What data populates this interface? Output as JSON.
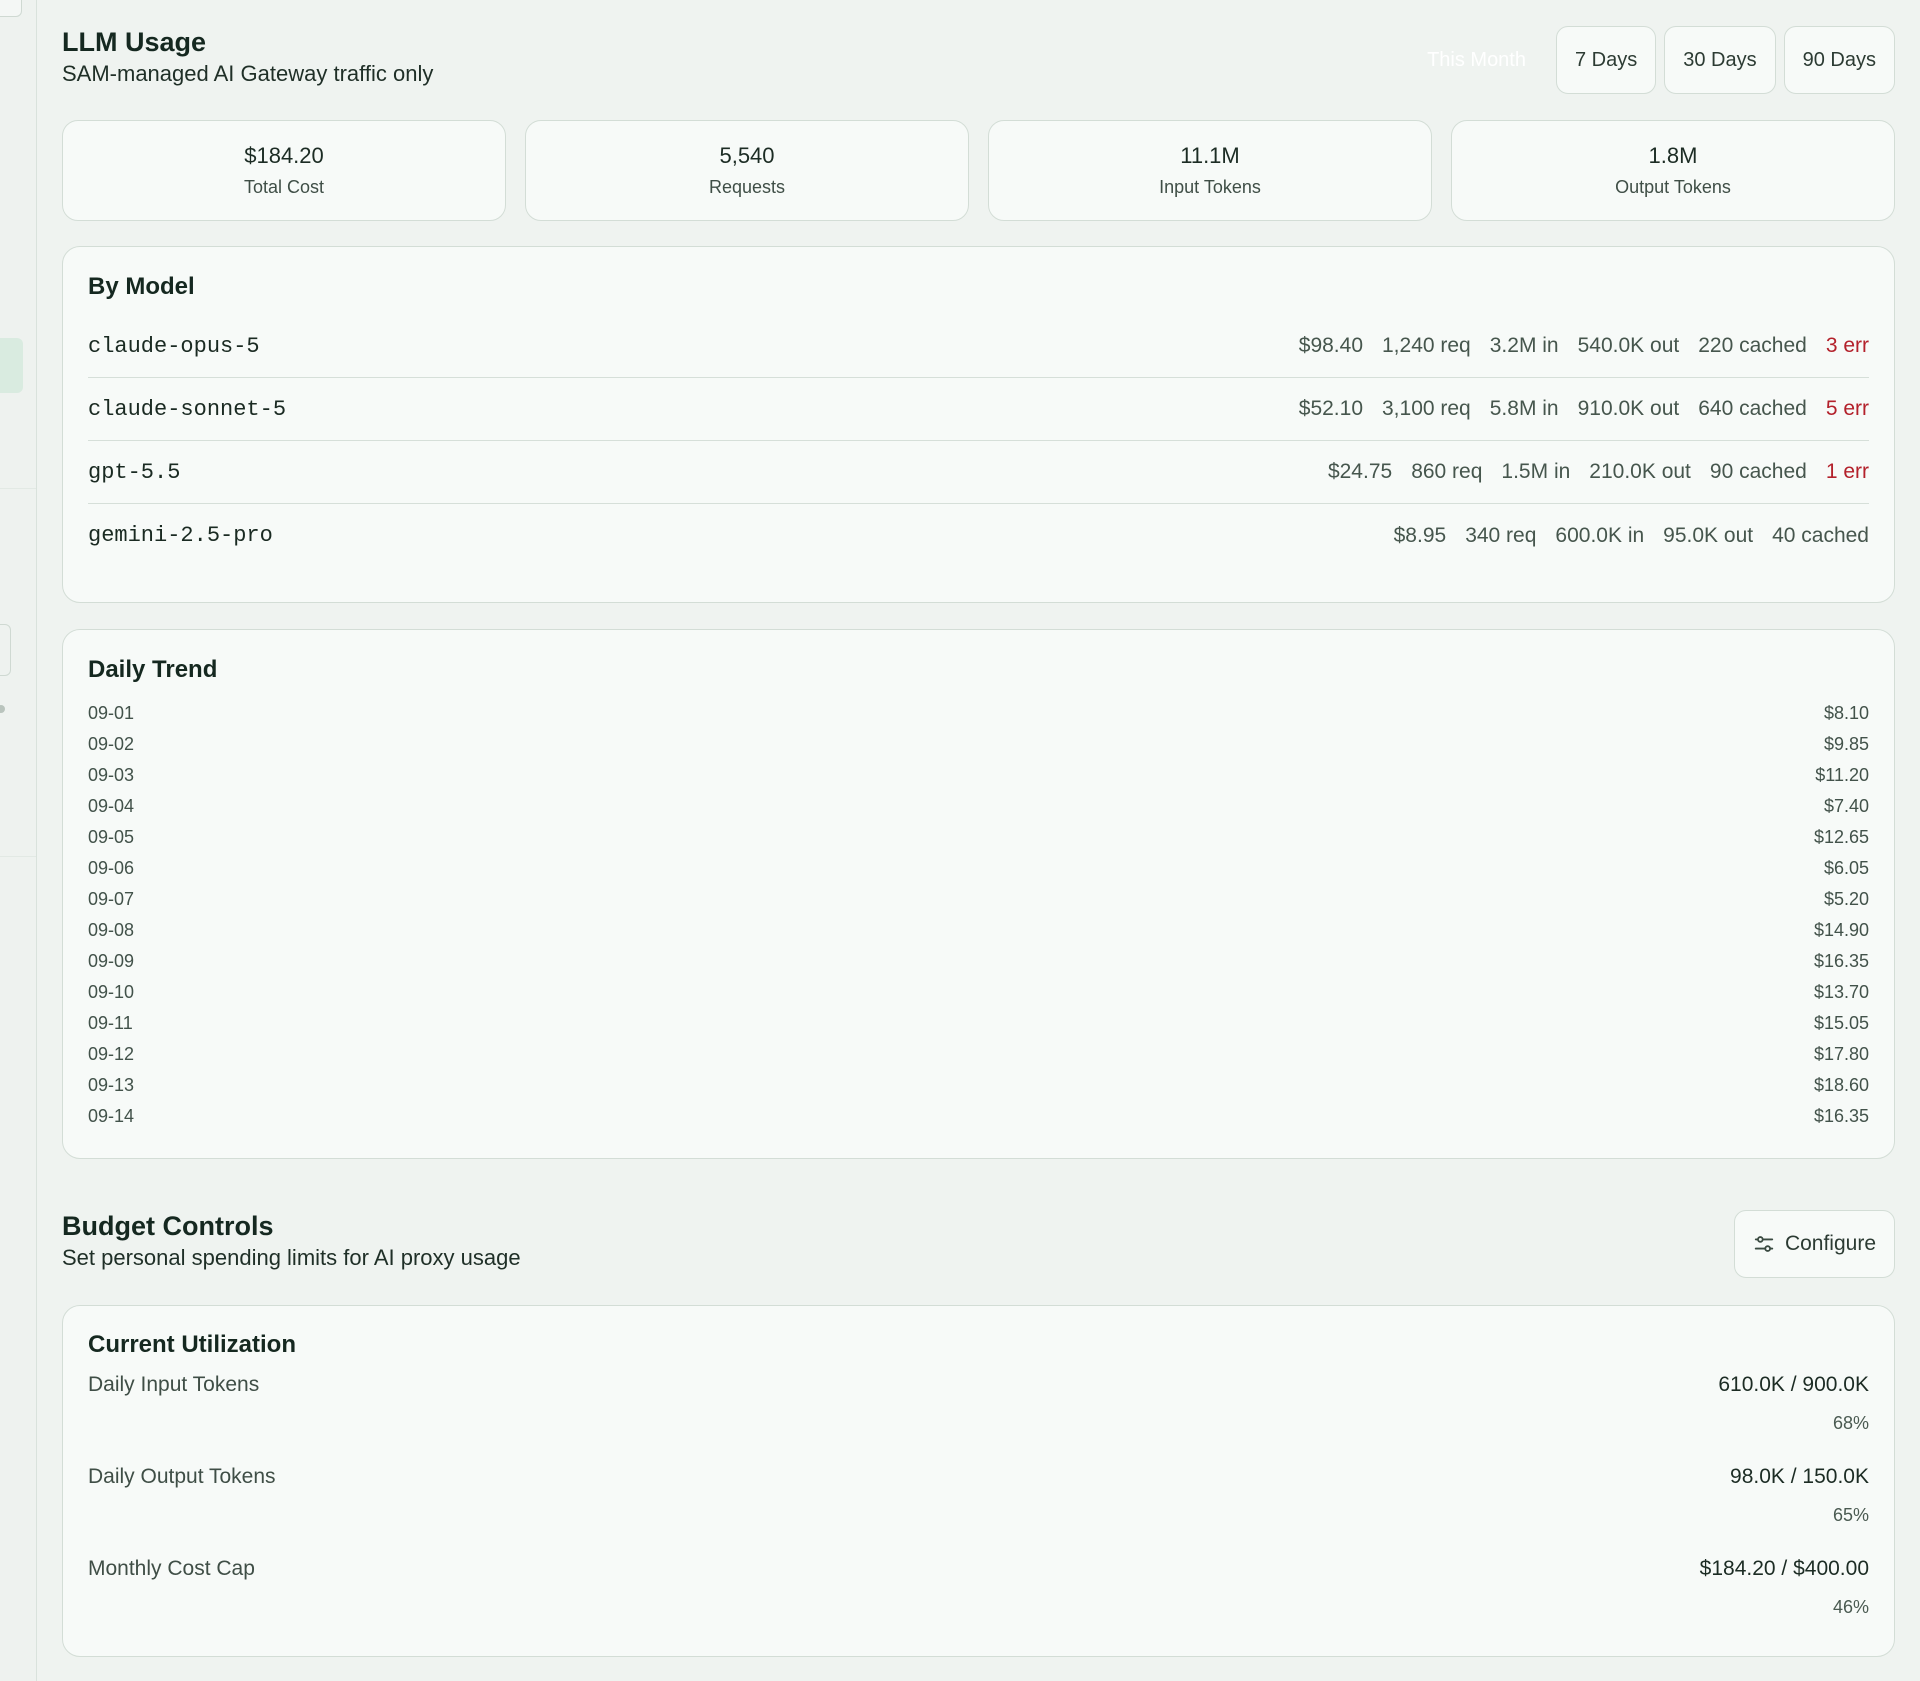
{
  "header": {
    "title": "LLM Usage",
    "subtitle": "SAM-managed AI Gateway traffic only"
  },
  "range": {
    "active": "This Month",
    "options": [
      "7 Days",
      "30 Days",
      "90 Days"
    ]
  },
  "stats": [
    {
      "value": "$184.20",
      "label": "Total Cost"
    },
    {
      "value": "5,540",
      "label": "Requests"
    },
    {
      "value": "11.1M",
      "label": "Input Tokens"
    },
    {
      "value": "1.8M",
      "label": "Output Tokens"
    }
  ],
  "by_model": {
    "title": "By Model",
    "rows": [
      {
        "name": "claude-opus-5",
        "cost": "$98.40",
        "req": "1,240 req",
        "in": "3.2M in",
        "out": "540.0K out",
        "cached": "220 cached",
        "err": "3 err"
      },
      {
        "name": "claude-sonnet-5",
        "cost": "$52.10",
        "req": "3,100 req",
        "in": "5.8M in",
        "out": "910.0K out",
        "cached": "640 cached",
        "err": "5 err"
      },
      {
        "name": "gpt-5.5",
        "cost": "$24.75",
        "req": "860 req",
        "in": "1.5M in",
        "out": "210.0K out",
        "cached": "90 cached",
        "err": "1 err"
      },
      {
        "name": "gemini-2.5-pro",
        "cost": "$8.95",
        "req": "340 req",
        "in": "600.0K in",
        "out": "95.0K out",
        "cached": "40 cached",
        "err": ""
      }
    ]
  },
  "daily_trend": {
    "title": "Daily Trend",
    "rows": [
      {
        "date": "09-01",
        "cost": "$8.10"
      },
      {
        "date": "09-02",
        "cost": "$9.85"
      },
      {
        "date": "09-03",
        "cost": "$11.20"
      },
      {
        "date": "09-04",
        "cost": "$7.40"
      },
      {
        "date": "09-05",
        "cost": "$12.65"
      },
      {
        "date": "09-06",
        "cost": "$6.05"
      },
      {
        "date": "09-07",
        "cost": "$5.20"
      },
      {
        "date": "09-08",
        "cost": "$14.90"
      },
      {
        "date": "09-09",
        "cost": "$16.35"
      },
      {
        "date": "09-10",
        "cost": "$13.70"
      },
      {
        "date": "09-11",
        "cost": "$15.05"
      },
      {
        "date": "09-12",
        "cost": "$17.80"
      },
      {
        "date": "09-13",
        "cost": "$18.60"
      },
      {
        "date": "09-14",
        "cost": "$16.35"
      }
    ]
  },
  "budget": {
    "title": "Budget Controls",
    "subtitle": "Set personal spending limits for AI proxy usage",
    "configure_label": "Configure",
    "configure_icon": "sliders-icon"
  },
  "utilization": {
    "title": "Current Utilization",
    "items": [
      {
        "label": "Daily Input Tokens",
        "value": "610.0K / 900.0K",
        "percent": "68%"
      },
      {
        "label": "Daily Output Tokens",
        "value": "98.0K / 150.0K",
        "percent": "65%"
      },
      {
        "label": "Monthly Cost Cap",
        "value": "$184.20 / $400.00",
        "percent": "46%"
      }
    ]
  },
  "colors": {
    "background": "#eff3f0",
    "card": "#f7faf8",
    "border": "#d3ddd6",
    "error": "#b3212b",
    "rail_active": "#d9ebe0"
  }
}
